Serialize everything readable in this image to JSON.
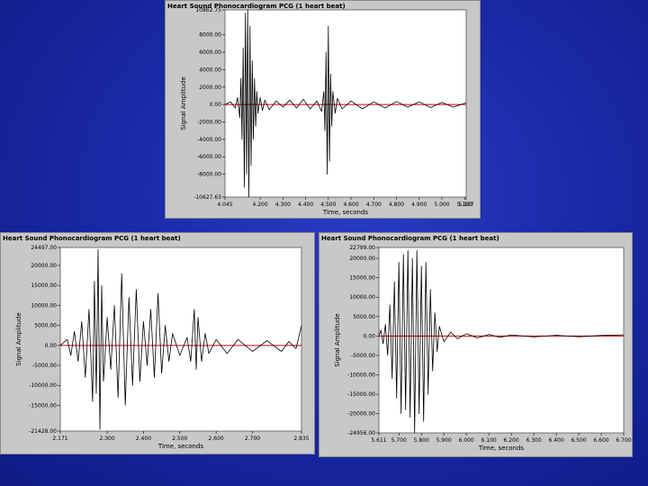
{
  "colors": {
    "trace": "#000000",
    "baseline": "#d40000",
    "plot_bg": "#ffffff",
    "panel_bg": "#c8c8c8"
  },
  "chart_data": [
    {
      "type": "line",
      "title": "Heart Sound Phonocardiogram PCG (1 heart beat)",
      "xlabel": "Time, seconds",
      "ylabel": "Signal Amplitude",
      "xlim": [
        4.045,
        5.107
      ],
      "ylim": [
        -10627.63,
        10862.75
      ],
      "x_ticks": [
        4.045,
        4.2,
        4.3,
        4.4,
        4.5,
        4.6,
        4.7,
        4.8,
        4.9,
        5.0,
        5.1,
        5.107
      ],
      "x_tick_labels": [
        "4.045",
        "4.200",
        "4.300",
        "4.400",
        "4.500",
        "4.600",
        "4.700",
        "4.800",
        "4.900",
        "5.000",
        "5.100",
        "5.107"
      ],
      "y_ticks": [
        10862.75,
        8000,
        6000,
        4000,
        2000,
        0,
        -2000,
        -4000,
        -6000,
        -8000,
        -10627.63
      ],
      "y_tick_labels": [
        "10862.75",
        "8000.00",
        "6000.00",
        "4000.00",
        "2000.00",
        "0.00",
        "-2000.00",
        "-4000.00",
        "-6000.00",
        "-8000.00",
        "-10627.63"
      ],
      "baseline": 0,
      "x": [
        4.045,
        4.07,
        4.09,
        4.1,
        4.11,
        4.115,
        4.12,
        4.125,
        4.13,
        4.135,
        4.14,
        4.145,
        4.15,
        4.155,
        4.16,
        4.165,
        4.17,
        4.175,
        4.18,
        4.185,
        4.19,
        4.2,
        4.21,
        4.22,
        4.24,
        4.27,
        4.3,
        4.33,
        4.36,
        4.39,
        4.42,
        4.45,
        4.47,
        4.48,
        4.485,
        4.49,
        4.495,
        4.5,
        4.505,
        4.51,
        4.515,
        4.52,
        4.53,
        4.54,
        4.56,
        4.6,
        4.65,
        4.7,
        4.75,
        4.8,
        4.85,
        4.9,
        4.95,
        5.0,
        5.05,
        5.107
      ],
      "y": [
        0,
        300,
        -400,
        800,
        -1500,
        3000,
        -4000,
        6500,
        -9500,
        10500,
        -8000,
        10862,
        -10627,
        9000,
        -7000,
        5000,
        -4000,
        3000,
        -2500,
        1500,
        -1000,
        800,
        -700,
        500,
        -600,
        400,
        -300,
        500,
        -400,
        600,
        -500,
        400,
        -800,
        1500,
        -3000,
        6000,
        -8000,
        9000,
        -6500,
        3500,
        -2500,
        1500,
        -1000,
        700,
        -500,
        400,
        -500,
        300,
        -400,
        350,
        -300,
        300,
        -350,
        250,
        -300,
        200
      ]
    },
    {
      "type": "line",
      "title": "Heart Sound Phonocardiogram PCG (1 heart beat)",
      "xlabel": "Time, seconds",
      "ylabel": "Signal Amplitude",
      "xlim": [
        2.171,
        2.835
      ],
      "ylim": [
        -21428,
        24497
      ],
      "x_ticks": [
        2.171,
        2.3,
        2.4,
        2.5,
        2.6,
        2.7,
        2.835
      ],
      "x_tick_labels": [
        "2.171",
        "2.300",
        "2.400",
        "2.500",
        "2.600",
        "2.700",
        "2.835"
      ],
      "y_ticks": [
        24497,
        20000,
        15000,
        10000,
        5000,
        0,
        -5000,
        -10000,
        -15000,
        -21428
      ],
      "y_tick_labels": [
        "24497.00",
        "20000.00",
        "15000.00",
        "10000.00",
        "5000.00",
        "0.00",
        "-5000.00",
        "-10000.00",
        "-15000.00",
        "-21428.00"
      ],
      "baseline": 0,
      "x": [
        2.171,
        2.19,
        2.2,
        2.21,
        2.22,
        2.23,
        2.24,
        2.25,
        2.26,
        2.265,
        2.27,
        2.275,
        2.28,
        2.285,
        2.29,
        2.3,
        2.31,
        2.32,
        2.33,
        2.34,
        2.35,
        2.36,
        2.37,
        2.38,
        2.39,
        2.4,
        2.41,
        2.42,
        2.43,
        2.44,
        2.45,
        2.46,
        2.47,
        2.48,
        2.5,
        2.52,
        2.53,
        2.54,
        2.545,
        2.55,
        2.56,
        2.57,
        2.58,
        2.6,
        2.63,
        2.66,
        2.7,
        2.74,
        2.78,
        2.8,
        2.82,
        2.835
      ],
      "y": [
        0,
        1500,
        -2500,
        3500,
        -4000,
        6000,
        -8000,
        9000,
        -14000,
        16000,
        -12000,
        24000,
        -21000,
        15000,
        -9000,
        7000,
        -6000,
        10000,
        -13000,
        18000,
        -15000,
        12000,
        -10000,
        14000,
        -9000,
        6000,
        -5000,
        9000,
        -8000,
        13000,
        -7000,
        5000,
        -4000,
        3000,
        -2500,
        2000,
        -4000,
        9000,
        -6000,
        7000,
        -4000,
        3000,
        -2000,
        1500,
        -2000,
        1500,
        -1500,
        1200,
        -1500,
        1000,
        -800,
        5000
      ]
    },
    {
      "type": "line",
      "title": "Heart Sound Phonocardiogram PCG (1 heart beat)",
      "xlabel": "Time, seconds",
      "ylabel": "Signal Amplitude",
      "xlim": [
        5.611,
        6.7
      ],
      "ylim": [
        -24956,
        22799
      ],
      "x_ticks": [
        5.611,
        5.7,
        5.8,
        5.9,
        6.0,
        6.1,
        6.2,
        6.3,
        6.4,
        6.5,
        6.6,
        6.7
      ],
      "x_tick_labels": [
        "5.611",
        "5.700",
        "5.800",
        "5.900",
        "6.000",
        "6.100",
        "6.200",
        "6.300",
        "6.400",
        "6.500",
        "6.600",
        "6.700"
      ],
      "y_ticks": [
        22799,
        20000,
        15000,
        10000,
        5000,
        0,
        -5000,
        -10000,
        -15000,
        -20000,
        -24956
      ],
      "y_tick_labels": [
        "22799.00",
        "20000.00",
        "15000.00",
        "10000.00",
        "5000.00",
        "0.00",
        "-5000.00",
        "-10000.00",
        "-15000.00",
        "-20000.00",
        "-24956.00"
      ],
      "baseline": 0,
      "x": [
        5.611,
        5.62,
        5.63,
        5.64,
        5.65,
        5.66,
        5.67,
        5.68,
        5.69,
        5.7,
        5.71,
        5.72,
        5.73,
        5.74,
        5.75,
        5.76,
        5.77,
        5.78,
        5.79,
        5.8,
        5.81,
        5.82,
        5.83,
        5.84,
        5.85,
        5.86,
        5.87,
        5.88,
        5.9,
        5.93,
        5.96,
        6.0,
        6.05,
        6.1,
        6.15,
        6.2,
        6.3,
        6.4,
        6.5,
        6.6,
        6.7
      ],
      "y": [
        0,
        1500,
        -2000,
        3000,
        -5000,
        8000,
        -11000,
        14000,
        -16000,
        19000,
        -20000,
        21000,
        -19000,
        22000,
        -21000,
        20000,
        -24900,
        22000,
        -20000,
        18000,
        -22000,
        19000,
        -15000,
        12000,
        -9000,
        6000,
        -4000,
        2500,
        -1500,
        1000,
        -700,
        600,
        -500,
        400,
        -350,
        300,
        -250,
        200,
        -200,
        150,
        300
      ]
    }
  ]
}
